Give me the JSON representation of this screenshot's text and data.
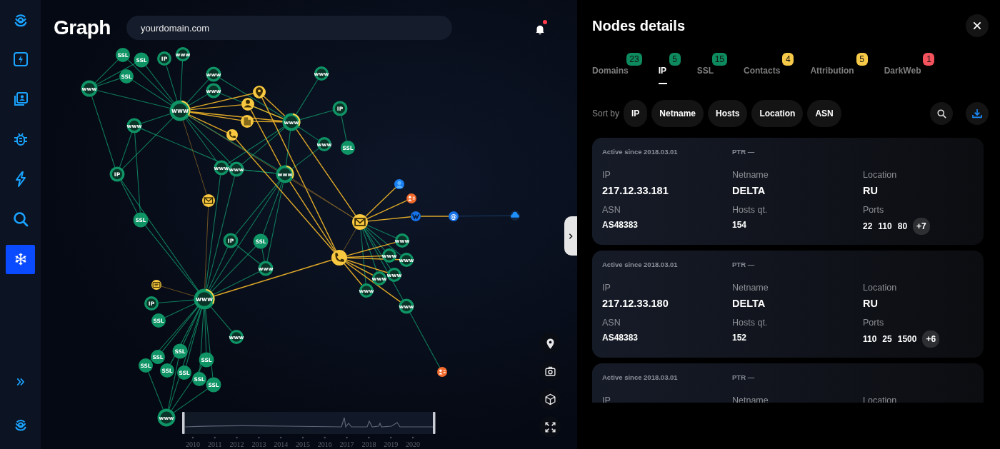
{
  "sidebar": {
    "items": [
      {
        "selected": false
      },
      {
        "selected": false
      },
      {
        "selected": false
      },
      {
        "selected": false
      },
      {
        "selected": false
      },
      {
        "selected": true
      }
    ]
  },
  "header": {
    "title": "Graph",
    "search": {
      "value": "yourdomain.com"
    },
    "notifications": {
      "unread": true
    }
  },
  "graph": {
    "nodes": [
      {
        "kind": "domain",
        "label": "www",
        "highlighted": false
      },
      {
        "kind": "domain",
        "label": "www",
        "highlighted": true
      },
      {
        "kind": "domain",
        "label": "www",
        "highlighted": false
      },
      {
        "kind": "domain",
        "label": "www",
        "highlighted": false
      },
      {
        "kind": "domain",
        "label": "www",
        "highlighted": false
      },
      {
        "kind": "domain",
        "label": "www",
        "highlighted": true
      },
      {
        "kind": "domain",
        "label": "www",
        "highlighted": false
      },
      {
        "kind": "domain",
        "label": "www",
        "highlighted": false
      },
      {
        "kind": "domain",
        "label": "www",
        "highlighted": false
      },
      {
        "kind": "domain",
        "label": "www",
        "highlighted": true
      },
      {
        "kind": "domain",
        "label": "www",
        "highlighted": false
      },
      {
        "kind": "domain",
        "label": "www",
        "highlighted": true
      },
      {
        "kind": "domain",
        "label": "www",
        "highlighted": false
      },
      {
        "kind": "domain",
        "label": "www",
        "highlighted": false
      },
      {
        "kind": "domain",
        "label": "www",
        "highlighted": false
      },
      {
        "kind": "domain",
        "label": "www",
        "highlighted": false
      },
      {
        "kind": "domain",
        "label": "www",
        "highlighted": false
      },
      {
        "kind": "domain",
        "label": "www",
        "highlighted": false
      },
      {
        "kind": "domain",
        "label": "www",
        "highlighted": false
      },
      {
        "kind": "domain",
        "label": "www",
        "highlighted": false
      },
      {
        "kind": "domain",
        "label": "www",
        "highlighted": false
      },
      {
        "kind": "domain",
        "label": "www",
        "highlighted": false
      },
      {
        "kind": "domain",
        "label": "www",
        "highlighted": false
      },
      {
        "kind": "ssl",
        "label": "SSL",
        "highlighted": false
      },
      {
        "kind": "ssl",
        "label": "SSL",
        "highlighted": false
      },
      {
        "kind": "ssl",
        "label": "SSL",
        "highlighted": false
      },
      {
        "kind": "ssl",
        "label": "SSL",
        "highlighted": false
      },
      {
        "kind": "ssl",
        "label": "SSL",
        "highlighted": false
      },
      {
        "kind": "ssl",
        "label": "SSL",
        "highlighted": false
      },
      {
        "kind": "ssl",
        "label": "SSL",
        "highlighted": false
      },
      {
        "kind": "ssl",
        "label": "SSL",
        "highlighted": false
      },
      {
        "kind": "ssl",
        "label": "SSL",
        "highlighted": false
      },
      {
        "kind": "ssl",
        "label": "SSL",
        "highlighted": false
      },
      {
        "kind": "ssl",
        "label": "SSL",
        "highlighted": false
      },
      {
        "kind": "ssl",
        "label": "SSL",
        "highlighted": false
      },
      {
        "kind": "ssl",
        "label": "SSL",
        "highlighted": false
      },
      {
        "kind": "ssl",
        "label": "SSL",
        "highlighted": false
      },
      {
        "kind": "ssl",
        "label": "SSL",
        "highlighted": false
      },
      {
        "kind": "ip",
        "label": "IP",
        "highlighted": false
      },
      {
        "kind": "ip",
        "label": "IP",
        "highlighted": false
      },
      {
        "kind": "ip",
        "label": "IP",
        "highlighted": false
      },
      {
        "kind": "ip",
        "label": "IP",
        "highlighted": false
      },
      {
        "kind": "ip",
        "label": "IP",
        "highlighted": false
      },
      {
        "kind": "location",
        "highlighted": false
      },
      {
        "kind": "person",
        "highlighted": false
      },
      {
        "kind": "organization",
        "highlighted": false
      },
      {
        "kind": "phone",
        "highlighted": false
      },
      {
        "kind": "email",
        "highlighted": false
      },
      {
        "kind": "email",
        "highlighted": false
      },
      {
        "kind": "phone",
        "highlighted": false
      },
      {
        "kind": "document",
        "highlighted": false
      },
      {
        "kind": "profile",
        "highlighted": false
      },
      {
        "kind": "contact",
        "highlighted": false
      },
      {
        "kind": "social",
        "highlighted": false
      },
      {
        "kind": "email_address",
        "label": "@",
        "highlighted": false
      },
      {
        "kind": "cloud",
        "highlighted": false
      },
      {
        "kind": "contact",
        "highlighted": false
      }
    ]
  },
  "timeline": {
    "years": [
      "2010",
      "2011",
      "2012",
      "2013",
      "2014",
      "2015",
      "2016",
      "2017",
      "2018",
      "2019",
      "2020"
    ]
  },
  "details": {
    "title": "Nodes details",
    "tabs": [
      {
        "label": "Domains",
        "count": "23",
        "color": "#0e8a5f",
        "selected": false
      },
      {
        "label": "IP",
        "count": "5",
        "color": "#0e8a5f",
        "selected": true
      },
      {
        "label": "SSL",
        "count": "15",
        "color": "#0e8a5f",
        "selected": false
      },
      {
        "label": "Contacts",
        "count": "4",
        "color": "#f7c948",
        "selected": false
      },
      {
        "label": "Attribution",
        "count": "5",
        "color": "#f7c948",
        "selected": false
      },
      {
        "label": "DarkWeb",
        "count": "1",
        "color": "#f4525c",
        "selected": false
      }
    ],
    "sort": {
      "label": "Sort by",
      "options": [
        "IP",
        "Netname",
        "Hosts",
        "Location",
        "ASN"
      ]
    },
    "cards": [
      {
        "active_since": "Active since 2018.03.01",
        "ptr": "PTR —",
        "rows": [
          [
            {
              "label": "IP",
              "value": "217.12.33.181"
            },
            {
              "label": "Netname",
              "value": "DELTA"
            },
            {
              "label": "Location",
              "value": "RU"
            }
          ],
          [
            {
              "label": "ASN",
              "value": "AS48383"
            },
            {
              "label": "Hosts qt.",
              "value": "154"
            },
            {
              "label": "Ports",
              "ports": [
                "22",
                "110",
                "80"
              ],
              "more": "+7"
            }
          ]
        ]
      },
      {
        "active_since": "Active since 2018.03.01",
        "ptr": "PTR —",
        "rows": [
          [
            {
              "label": "IP",
              "value": "217.12.33.180"
            },
            {
              "label": "Netname",
              "value": "DELTA"
            },
            {
              "label": "Location",
              "value": "RU"
            }
          ],
          [
            {
              "label": "ASN",
              "value": "AS48383"
            },
            {
              "label": "Hosts qt.",
              "value": "152"
            },
            {
              "label": "Ports",
              "ports": [
                "110",
                "25",
                "1500"
              ],
              "more": "+6"
            }
          ]
        ]
      },
      {
        "active_since": "Active since 2018.03.01",
        "ptr": "PTR —",
        "rows": [
          [
            {
              "label": "IP"
            },
            {
              "label": "Netname"
            },
            {
              "label": "Location"
            }
          ]
        ]
      }
    ]
  }
}
